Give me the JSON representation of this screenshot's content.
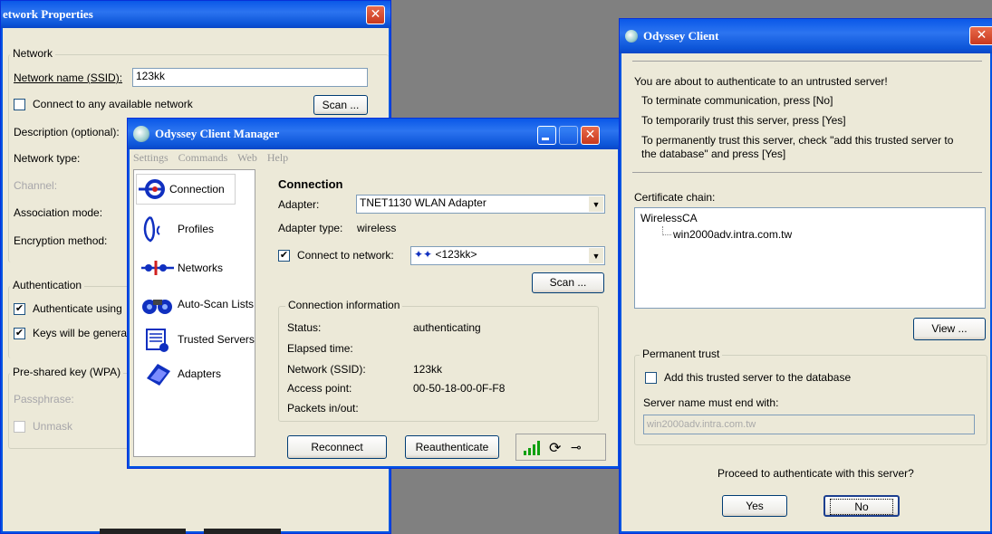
{
  "network_properties": {
    "title": "etwork Properties",
    "close_glyph": "✕",
    "network_group": "Network",
    "ssid_label": "Network name (SSID):",
    "ssid_value": "123kk",
    "connect_any_label": "Connect to any available network",
    "scan_label": "Scan ...",
    "description_label": "Description (optional):",
    "network_type_label": "Network type:",
    "channel_label": "Channel:",
    "association_label": "Association mode:",
    "encryption_label": "Encryption method:",
    "auth_group": "Authentication",
    "authenticate_label": "Authenticate using",
    "keys_label": "Keys will be generat",
    "psk_group": "Pre-shared key (WPA)",
    "passphrase_label": "Passphrase:",
    "unmask_label": "Unmask"
  },
  "manager": {
    "title": "Odyssey Client Manager",
    "menu": [
      "Settings",
      "Commands",
      "Web",
      "Help"
    ],
    "nav": [
      {
        "label": "Connection",
        "icon": "connection-icon"
      },
      {
        "label": "Profiles",
        "icon": "profiles-icon"
      },
      {
        "label": "Networks",
        "icon": "networks-icon"
      },
      {
        "label": "Auto-Scan Lists",
        "icon": "autoscan-icon"
      },
      {
        "label": "Trusted Servers",
        "icon": "trusted-servers-icon"
      },
      {
        "label": "Adapters",
        "icon": "adapters-icon"
      }
    ],
    "section_title": "Connection",
    "adapter_label": "Adapter:",
    "adapter_value": "TNET1130 WLAN Adapter",
    "adapter_type_label": "Adapter type:",
    "adapter_type_value": "wireless",
    "connect_label": "Connect to network:",
    "network_value": "<123kk>",
    "scan_label": "Scan ...",
    "info_group": "Connection information",
    "status_label": "Status:",
    "status_value": "authenticating",
    "elapsed_label": "Elapsed time:",
    "ssid_label": "Network (SSID):",
    "ssid_value": "123kk",
    "ap_label": "Access point:",
    "ap_value": "00-50-18-00-0F-F8",
    "packets_label": "Packets in/out:",
    "reconnect_label": "Reconnect",
    "reauth_label": "Reauthenticate"
  },
  "odyssey_client": {
    "title": "Odyssey Client",
    "message_1": "You are about to authenticate to an untrusted server!",
    "message_2": "To terminate communication, press [No]",
    "message_3": "To temporarily trust this server, press [Yes]",
    "message_4": "To permanently trust this server, check \"add this trusted server to",
    "message_5": "the database\" and press [Yes]",
    "chain_label": "Certificate chain:",
    "chain_root": "WirelessCA",
    "chain_leaf": "win2000adv.intra.com.tw",
    "view_label": "View ...",
    "trust_group": "Permanent trust",
    "add_trusted_label": "Add this trusted server to the database",
    "server_name_label": "Server name must end with:",
    "server_name_value": "win2000adv.intra.com.tw",
    "proceed_text": "Proceed to authenticate with this server?",
    "yes_label": "Yes",
    "no_label": "No"
  }
}
